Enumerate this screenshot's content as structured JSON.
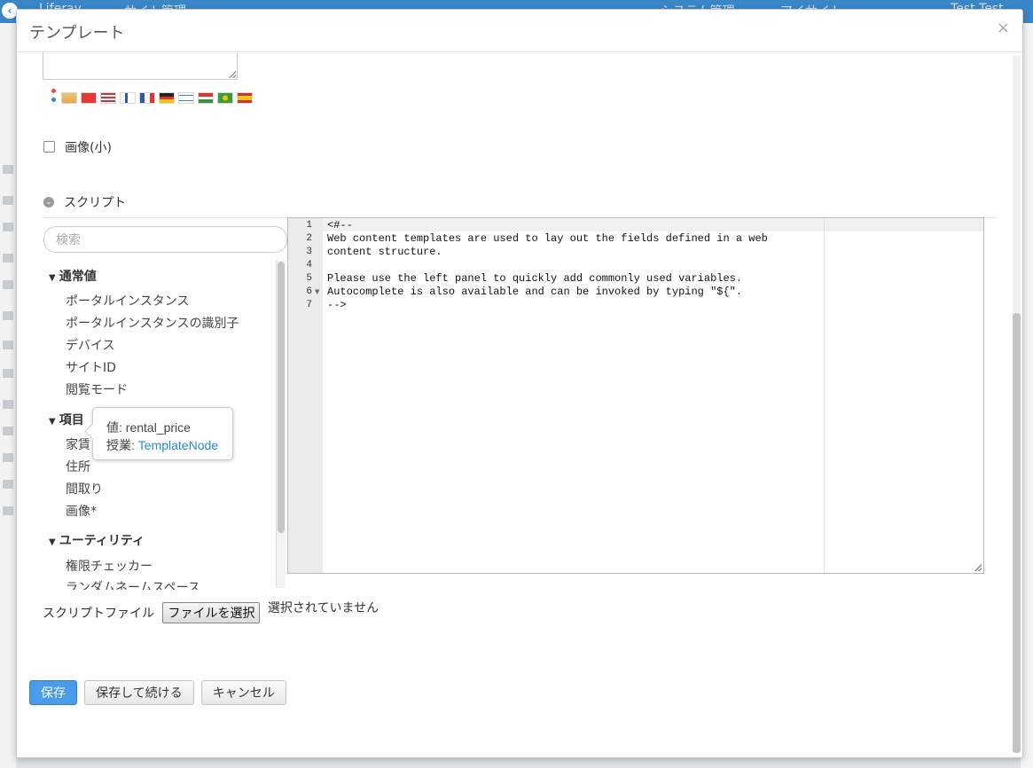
{
  "background": {
    "topbar_left": "Liferay",
    "topbar_title": "サイト管理",
    "topbar_right_1": "システム管理",
    "topbar_right_2": "マイサイト",
    "user": "Test Test"
  },
  "modal": {
    "title": "テンプレート",
    "close": "×"
  },
  "fields": {
    "small_image_label": "画像(小)"
  },
  "script_section": {
    "title": "スクリプト",
    "search_placeholder": "検索"
  },
  "variables": {
    "groups": [
      {
        "title": "通常値",
        "items": [
          "ポータルインスタンス",
          "ポータルインスタンスの識別子",
          "デバイス",
          "サイトID",
          "閲覧モード"
        ]
      },
      {
        "title": "項目",
        "items": [
          "家賃",
          "住所",
          "間取り",
          "画像*"
        ]
      },
      {
        "title": "ユーティリティ",
        "items": [
          "権限チェッカー",
          "ランダムネームスペース"
        ]
      }
    ]
  },
  "tooltip": {
    "value_label": "値:",
    "value": "rental_price",
    "type_label": "授業:",
    "type_value": "TemplateNode"
  },
  "editor": {
    "lines": [
      {
        "num": "1",
        "text": "<#--"
      },
      {
        "num": "2",
        "text": "Web content templates are used to lay out the fields defined in a web"
      },
      {
        "num": "3",
        "text": "content structure."
      },
      {
        "num": "4",
        "text": ""
      },
      {
        "num": "5",
        "text": "Please use the left panel to quickly add commonly used variables."
      },
      {
        "num": "6",
        "text": "Autocomplete is also available and can be invoked by typing \"${\"."
      },
      {
        "num": "7",
        "text": "-->"
      }
    ]
  },
  "script_file": {
    "label": "スクリプトファイル",
    "button": "ファイルを選択",
    "status": "選択されていません"
  },
  "buttons": {
    "save": "保存",
    "save_continue": "保存して続ける",
    "cancel": "キャンセル"
  },
  "colors": {
    "primary": "#4a9be8",
    "link": "#2a8ccf",
    "topbar": "#3a87c8"
  }
}
